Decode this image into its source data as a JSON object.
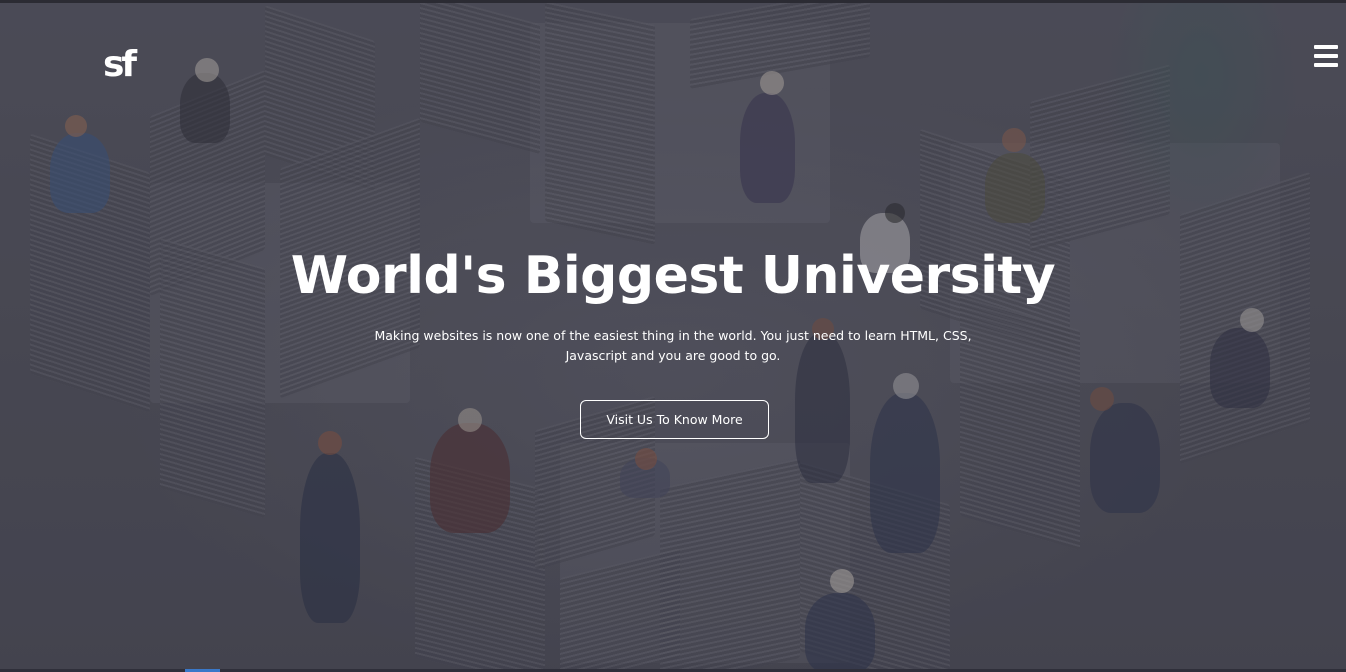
{
  "header": {
    "logo_text": "sf",
    "menu_icon": "hamburger-menu-icon"
  },
  "hero": {
    "title": "World's Biggest University",
    "subtitle": "Making websites is now one of the easiest thing in the world. You just need to learn HTML, CSS, Javascript and you are good to go.",
    "cta_label": "Visit Us To Know More"
  },
  "colors": {
    "text": "#ffffff",
    "overlay": "#2d2d3a",
    "accent": "#3a78c9"
  }
}
